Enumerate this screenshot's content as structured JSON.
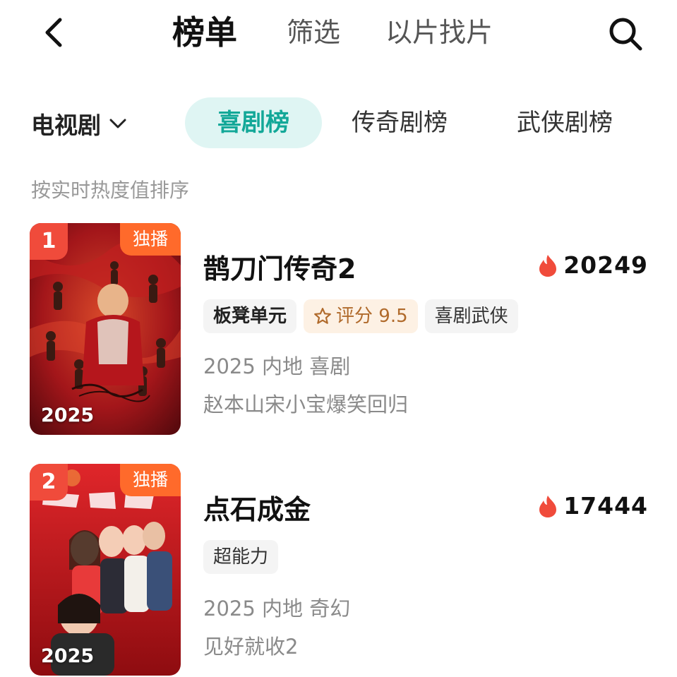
{
  "header": {
    "tabs": [
      {
        "label": "榜单",
        "active": true
      },
      {
        "label": "筛选",
        "active": false
      },
      {
        "label": "以片找片",
        "active": false
      }
    ],
    "icons": {
      "back": "chevron-left-icon",
      "search": "search-icon"
    }
  },
  "category": {
    "selected": "电视剧",
    "chips": [
      {
        "label": "喜剧榜",
        "active": true
      },
      {
        "label": "传奇剧榜",
        "active": false
      },
      {
        "label": "武侠剧榜",
        "active": false
      }
    ]
  },
  "sort_note": "按实时热度值排序",
  "colors": {
    "accent": "#13a898",
    "accent_bg": "#dff5f3",
    "rank_badge": "#f04b3b",
    "exclusive_badge": "#ff6a2b",
    "heat_icon": "#f04b3b",
    "score_text": "#b06a2b",
    "score_bg": "#fdf1e4"
  },
  "list": [
    {
      "rank": "1",
      "exclusive": "独播",
      "poster_year": "2025",
      "title": "鹊刀门传奇2",
      "heat": "20249",
      "tags": [
        {
          "label": "板凳单元",
          "kind": "brand"
        },
        {
          "label": "评分 9.5",
          "kind": "score"
        },
        {
          "label": "喜剧武侠",
          "kind": "plain"
        }
      ],
      "meta": "2025 内地 喜剧",
      "desc": "赵本山宋小宝爆笑回归"
    },
    {
      "rank": "2",
      "exclusive": "独播",
      "poster_year": "2025",
      "title": "点石成金",
      "heat": "17444",
      "tags": [
        {
          "label": "超能力",
          "kind": "plain"
        }
      ],
      "meta": "2025 内地 奇幻",
      "desc": "见好就收2"
    }
  ]
}
